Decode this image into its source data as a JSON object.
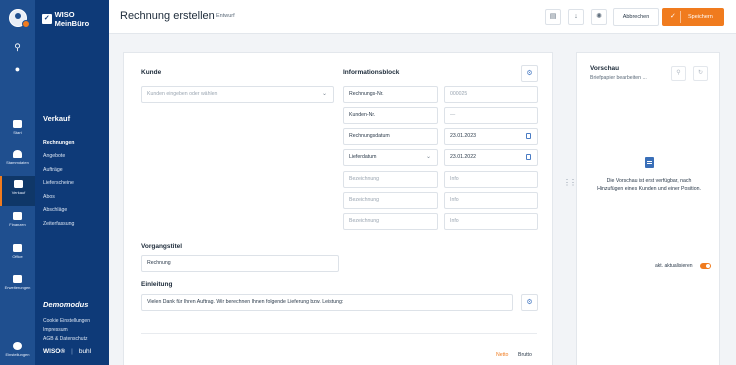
{
  "app": {
    "logo_text": "WISO MeinBüro",
    "brand_wiso": "WISO®",
    "brand_buhl": "buhl"
  },
  "rail": {
    "items": [
      {
        "label": "Start"
      },
      {
        "label": "Stammdaten"
      },
      {
        "label": "Verkauf"
      },
      {
        "label": "Finanzen"
      },
      {
        "label": "Office"
      },
      {
        "label": "Erweiterungen"
      },
      {
        "label": "Einstellungen"
      }
    ]
  },
  "nav": {
    "heading": "Verkauf",
    "items": [
      {
        "label": "Rechnungen",
        "active": true
      },
      {
        "label": "Angebote"
      },
      {
        "label": "Aufträge"
      },
      {
        "label": "Lieferscheine"
      },
      {
        "label": "Abos"
      },
      {
        "label": "Abschläge"
      },
      {
        "label": "Zeiterfassung"
      }
    ],
    "demo_label": "Demomodus",
    "footer_links": [
      "Cookie Einstellungen",
      "Impressum",
      "AGB & Datenschutz"
    ]
  },
  "header": {
    "title": "Rechnung erstellen",
    "status": "Entwurf",
    "cancel_label": "Abbrechen",
    "save_label": "Speichern"
  },
  "form": {
    "kunde_label": "Kunde",
    "kunde_placeholder": "Kunden eingeben oder wählen",
    "info_label": "Informationsblock",
    "info_rows": [
      {
        "label": "Rechnungs-Nr.",
        "value": "000025"
      },
      {
        "label": "Kunden-Nr.",
        "value": "—"
      },
      {
        "label": "Rechnungsdatum",
        "value": "23.01.2023"
      },
      {
        "label": "Lieferdatum",
        "value": "23.01.2022"
      },
      {
        "label": "Bezeichnung",
        "value": "Info"
      },
      {
        "label": "Bezeichnung",
        "value": "Info"
      },
      {
        "label": "Bezeichnung",
        "value": "Info"
      }
    ],
    "vorgangstitel_label": "Vorgangstitel",
    "vorgangstitel_value": "Rechnung",
    "einleitung_label": "Einleitung",
    "einleitung_value": "Vielen Dank für Ihren Auftrag. Wir berechnen Ihnen folgende Lieferung bzw. Leistung:",
    "netto_label": "Netto",
    "brutto_label": "Brutto"
  },
  "preview": {
    "title": "Vorschau",
    "subtitle": "Briefpapier bearbeiten ...",
    "message": "Die Vorschau ist erst verfügbar, nach Hinzufügen eines Kunden und einer Position.",
    "auto_update_label": "akt. aktualisieren",
    "auto_update_on": true
  },
  "colors": {
    "accent": "#f07b1e",
    "nav_bg": "#0e3a78",
    "rail_bg": "#1f4f8f",
    "link_blue": "#4a7cc4"
  }
}
